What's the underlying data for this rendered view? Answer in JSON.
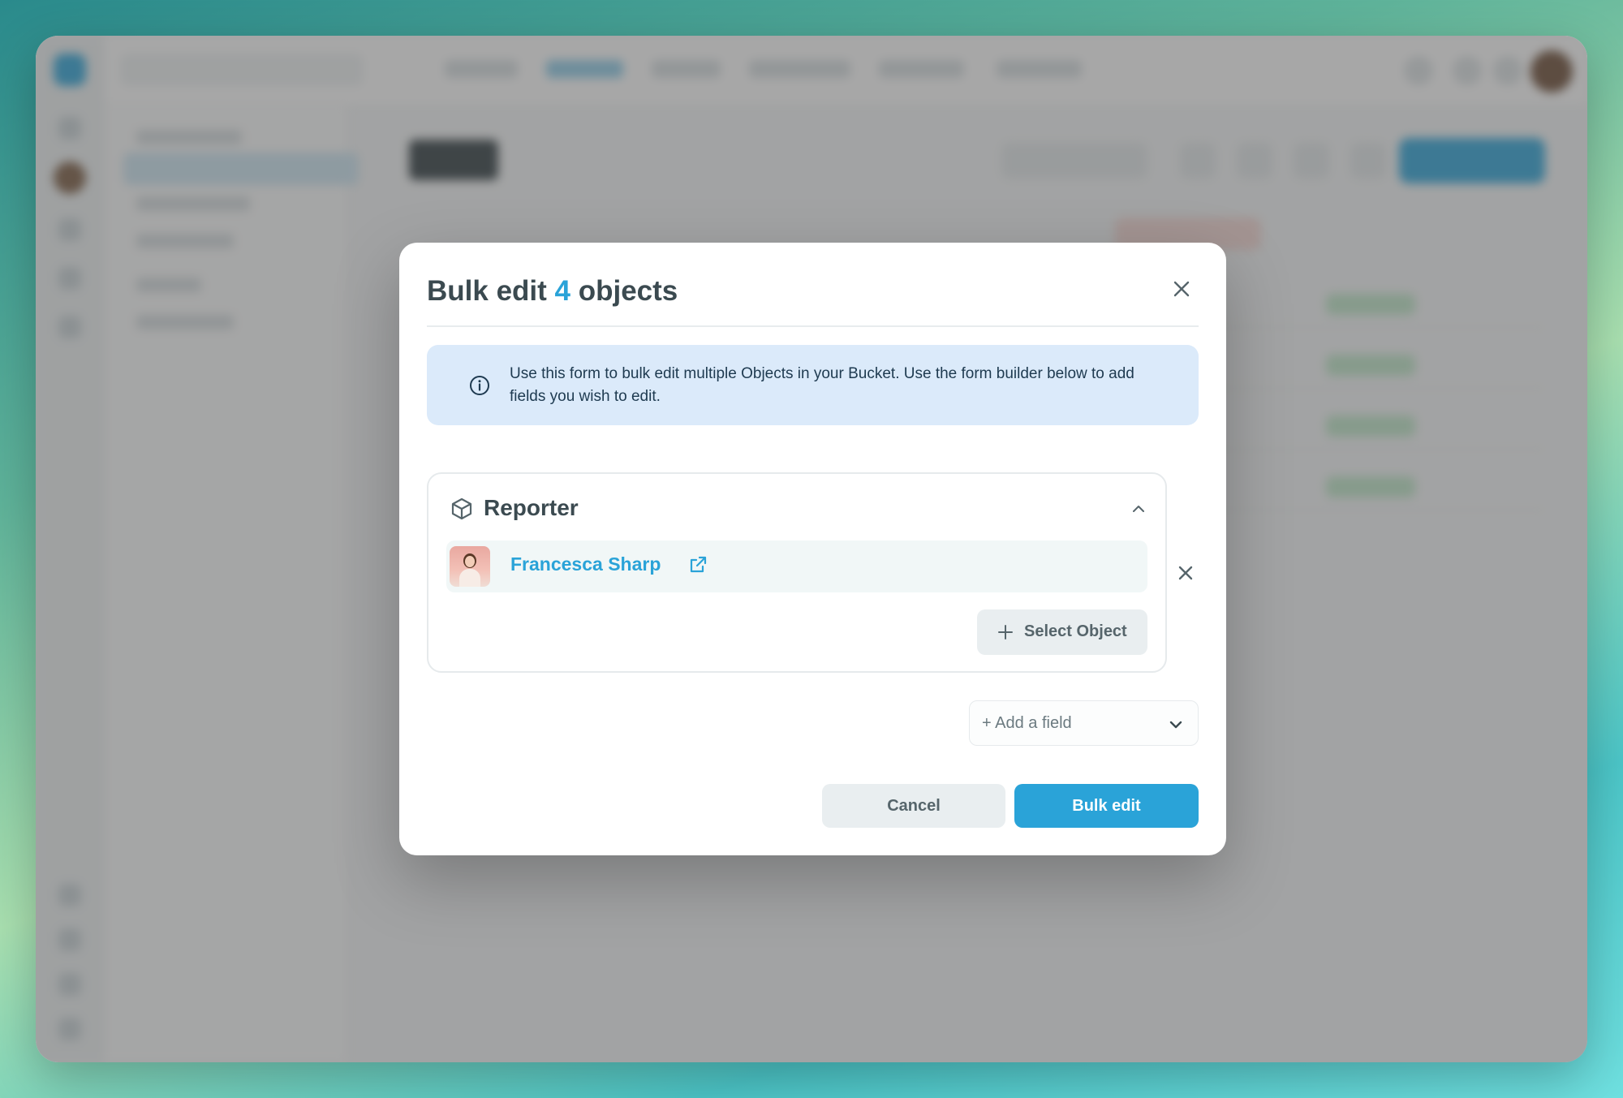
{
  "modal": {
    "title_prefix": "Bulk edit",
    "count": "4",
    "title_suffix": "objects",
    "info_text": "Use this form to bulk edit multiple Objects in your Bucket. Use the form builder below to add fields you wish to edit.",
    "field": {
      "label": "Reporter",
      "icon": "cube-icon",
      "object_name": "Francesca Sharp",
      "select_object_label": "Select Object"
    },
    "add_field_placeholder": "+ Add a field",
    "cancel_label": "Cancel",
    "submit_label": "Bulk edit"
  },
  "colors": {
    "accent": "#2aa3d8",
    "info_bg": "#dbeafa",
    "title_text": "#3b4a50"
  }
}
